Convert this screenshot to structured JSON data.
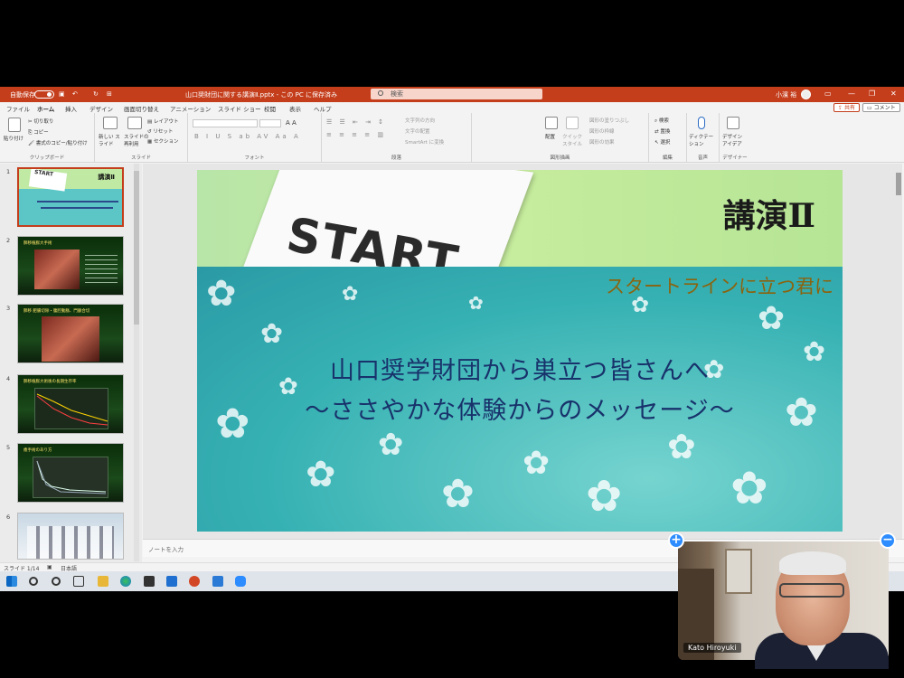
{
  "titlebar": {
    "autosave": "自動保存",
    "autosave_state": "オフ",
    "doc_title": "山口奨財団に関する講演Ⅱ.pptx - この PC に保存済み",
    "search_placeholder": "検索",
    "user": "小濱 裕"
  },
  "tabs": [
    {
      "label": "ファイル"
    },
    {
      "label": "ホーム"
    },
    {
      "label": "挿入"
    },
    {
      "label": "デザイン"
    },
    {
      "label": "画面切り替え"
    },
    {
      "label": "アニメーション"
    },
    {
      "label": "スライド ショー"
    },
    {
      "label": "校閲"
    },
    {
      "label": "表示"
    },
    {
      "label": "ヘルプ"
    }
  ],
  "share": "共有",
  "comment": "コメント",
  "ribbon": {
    "clipboard": {
      "paste": "貼り付け",
      "cut": "切り取り",
      "copy": "コピー",
      "format_painter": "書式のコピー/貼り付け",
      "label": "クリップボード"
    },
    "slides": {
      "new_slide": "新しい スライド",
      "reuse": "スライドの 再利用",
      "layout": "レイアウト",
      "reset": "リセット",
      "section": "セクション",
      "label": "スライド"
    },
    "font": {
      "label": "フォント"
    },
    "paragraph": {
      "text_direction": "文字列の方向",
      "align_text": "文字の配置",
      "smartart": "SmartArt に変換",
      "label": "段落"
    },
    "drawing": {
      "arrange": "配置",
      "quick_styles": "クイック スタイル",
      "fill": "図形の塗りつぶし",
      "outline": "図形の枠線",
      "effects": "図形の効果",
      "label": "図形描画"
    },
    "editing": {
      "find": "検索",
      "replace": "置換",
      "select": "選択",
      "label": "編集"
    },
    "voice": {
      "dictate": "ディクテーション",
      "label": "音声"
    },
    "designer": {
      "ideas": "デザイン アイデア",
      "label": "デザイナー"
    }
  },
  "thumbnails": [
    {
      "num": "1",
      "title": "講演Ⅱ"
    },
    {
      "num": "2",
      "title": "肺移植膨大手術"
    },
    {
      "num": "3",
      "title": "肺移 肥腸切除・腹腔動脈、門脈合切"
    },
    {
      "num": "4",
      "title": "肺移植膨大術後の長期生存率"
    },
    {
      "num": "5",
      "title": "癒手術のあり方"
    },
    {
      "num": "6",
      "title": ""
    }
  ],
  "slide": {
    "start_word": "START",
    "title": "講演Ⅱ",
    "subtitle": "スタートラインに立つ君に",
    "main_line1": "山口奨学財団から巣立つ皆さんへ",
    "main_line2": "～ささやかな体験からのメッセージ～"
  },
  "notes_placeholder": "ノートを入力",
  "status": {
    "slide_info": "スライド 1/14",
    "language": "日本語"
  },
  "video": {
    "participant_name": "Kato Hiroyuki"
  },
  "colors": {
    "accent": "#c43e1c",
    "zoom_blue": "#2d8cff"
  }
}
